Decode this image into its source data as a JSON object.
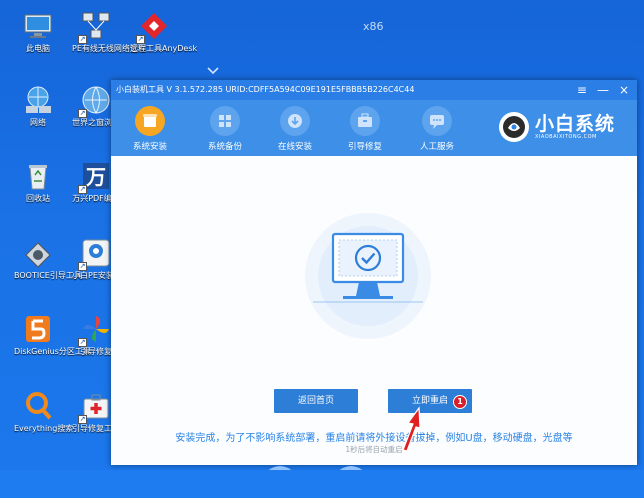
{
  "desktop": {
    "watermark": "x86",
    "icons": [
      {
        "label": "此电脑"
      },
      {
        "label": "PE有线无线网络管理"
      },
      {
        "label": "远程工具AnyDesk"
      },
      {
        "label": "网络"
      },
      {
        "label": "世界之窗浏览器"
      },
      {
        "label": "回收站"
      },
      {
        "label": "万兴PDF编辑"
      },
      {
        "label": "BOOTICE引导工具"
      },
      {
        "label": "小白PE安装工具"
      },
      {
        "label": "DiskGenius分区工具"
      },
      {
        "label": "引导修复"
      },
      {
        "label": "Everything搜索"
      },
      {
        "label": "引导修复工具"
      }
    ]
  },
  "window": {
    "title": "小白装机工具 V 3.1.572.285 URID:CDFF5A594C09E191E5FBBB5B226C4C44",
    "controls": [
      "≡",
      "—",
      "×"
    ],
    "nav": [
      {
        "label": "系统安装",
        "icon": "install-icon",
        "active": true
      },
      {
        "label": "系统备份",
        "icon": "backup-icon",
        "active": false
      },
      {
        "label": "在线安装",
        "icon": "download-icon",
        "active": false
      },
      {
        "label": "引导修复",
        "icon": "toolbox-icon",
        "active": false
      },
      {
        "label": "人工服务",
        "icon": "chat-icon",
        "active": false
      }
    ],
    "brand": {
      "name": "小白系统",
      "sub": "XIAOBAIXITONG.COM"
    },
    "message": "安装完成，为了不影响系统部署，重启前请将外接设备拔掉，例如U盘，移动硬盘，光盘等",
    "countdown": "1秒后将自动重启",
    "buttons": {
      "home": "返回首页",
      "restart": "立即重启"
    },
    "badge": "1"
  },
  "colors": {
    "desktop": "#1a72e6",
    "titlebar": "#2a7ee6",
    "navbar": "#3d8fe8",
    "active": "#f6a623",
    "button": "#2d7ed6",
    "message": "#2b84e6",
    "badge": "#d8202a",
    "arrow": "#e02020"
  }
}
